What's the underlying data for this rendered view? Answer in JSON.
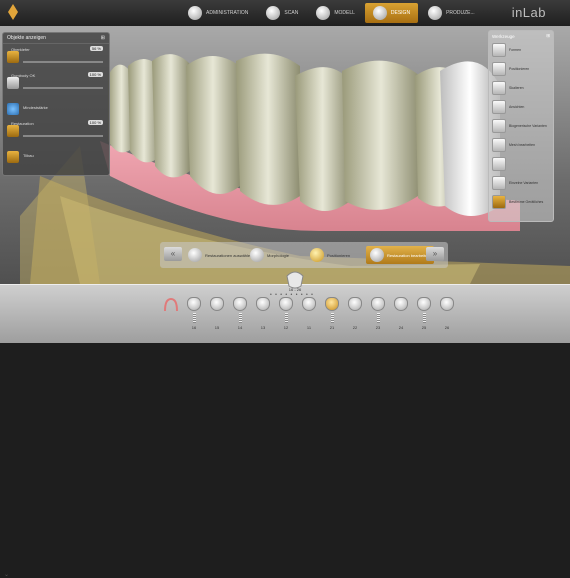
{
  "header": {
    "brand": "inLab",
    "steps": [
      {
        "label": "ADMINISTRATION",
        "icon": "administration-icon"
      },
      {
        "label": "SCAN",
        "icon": "scan-icon"
      },
      {
        "label": "MODELL",
        "icon": "model-icon"
      },
      {
        "label": "DESIGN",
        "icon": "design-icon"
      },
      {
        "label": "PRODUZE...",
        "icon": "produce-icon"
      }
    ],
    "active_step": "DESIGN"
  },
  "left_panel": {
    "title": "Objekte anzeigen",
    "rows": [
      {
        "label": "Oberkiefer",
        "value": "56 %",
        "icon": "upper-jaw-icon"
      },
      {
        "label": "Gumbody OK",
        "value": "100 %",
        "icon": "gum-body-icon"
      },
      {
        "label": "Mindeststärke",
        "value": "",
        "icon": "min-thickness-icon"
      },
      {
        "label": "Restauration",
        "value": "100 %",
        "icon": "restoration-icon"
      },
      {
        "label": "Tilbau",
        "value": "",
        "icon": "tilbau-icon"
      }
    ]
  },
  "right_panel": {
    "title": "Werkzeuge",
    "items": [
      {
        "label": "Formen"
      },
      {
        "label": "Positionieren"
      },
      {
        "label": "Skalieren"
      },
      {
        "label": "Ansichten"
      },
      {
        "label": "Biogenerische Varianten"
      },
      {
        "label": "Mesh bearbeiten"
      },
      {
        "label": ""
      },
      {
        "label": "Einzelne Varianten"
      },
      {
        "label": "Bestimme Gerätliches"
      }
    ],
    "selected_index": 8
  },
  "sub_steps": [
    {
      "label": "Restaurationen auswählen"
    },
    {
      "label": "Morphologie"
    },
    {
      "label": "Positionieren"
    },
    {
      "label": "Restauration bearbeiten"
    }
  ],
  "active_sub_step": "Restauration bearbeiten",
  "tooth_range": "16 - 26",
  "teeth": [
    {
      "num": "16",
      "implant": true
    },
    {
      "num": "15",
      "implant": false
    },
    {
      "num": "14",
      "implant": true
    },
    {
      "num": "13",
      "implant": false
    },
    {
      "num": "12",
      "implant": true
    },
    {
      "num": "11",
      "implant": false
    },
    {
      "num": "21",
      "implant": true,
      "selected": true
    },
    {
      "num": "22",
      "implant": false
    },
    {
      "num": "23",
      "implant": true
    },
    {
      "num": "24",
      "implant": false
    },
    {
      "num": "25",
      "implant": true
    },
    {
      "num": "26",
      "implant": false
    }
  ]
}
